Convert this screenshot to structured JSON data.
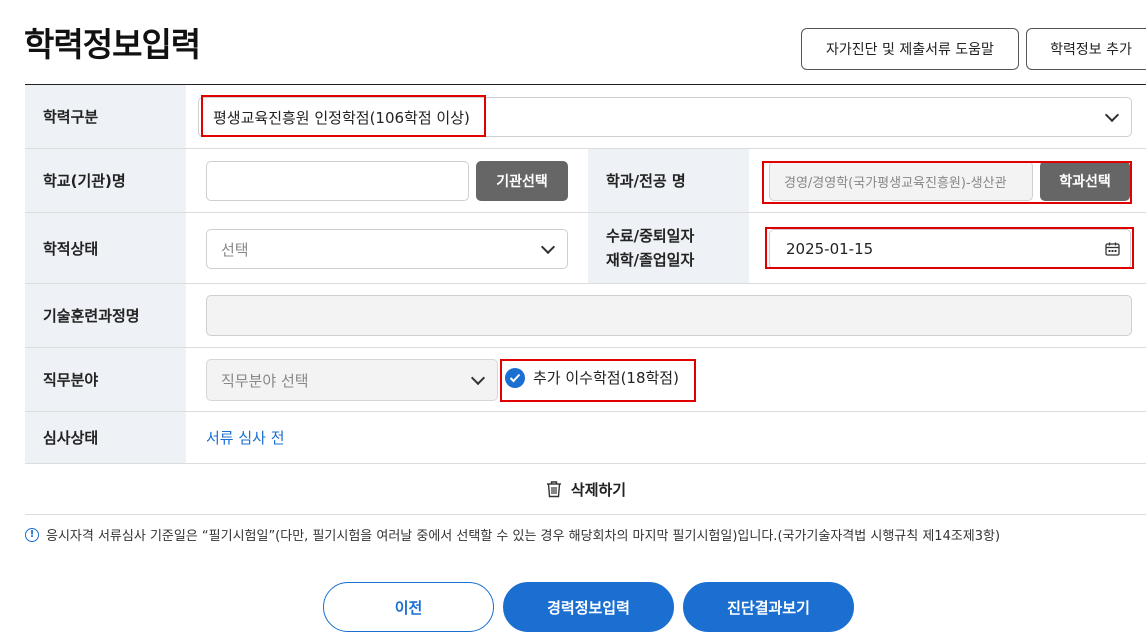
{
  "page": {
    "title": "학력정보입력"
  },
  "top_buttons": {
    "help": "자가진단 및 제출서류 도움말",
    "add": "학력정보 추가"
  },
  "form": {
    "education_type": {
      "label": "학력구분",
      "value": "평생교육진흥원 인정학점(106학점 이상)"
    },
    "school": {
      "label": "학교(기관)명",
      "value": "",
      "button": "기관선택"
    },
    "major": {
      "label": "학과/전공 명",
      "value": "경영/경영학(국가평생교육진흥원)-생산관",
      "button": "학과선택"
    },
    "status": {
      "label": "학적상태",
      "value": "선택"
    },
    "date": {
      "label_line1": "수료/중퇴일자",
      "label_line2": "재학/졸업일자",
      "value": "2025-01-15"
    },
    "training": {
      "label": "기술훈련과정명",
      "value": ""
    },
    "job_field": {
      "label": "직무분야",
      "value": "직무분야 선택",
      "checkbox_label": "추가 이수학점(18학점)",
      "checked": true
    },
    "review": {
      "label": "심사상태",
      "value": "서류 심사 전"
    }
  },
  "delete_label": "삭제하기",
  "notice": "응시자격 서류심사 기준일은 “필기시험일”(다만, 필기시험을 여러날 중에서 선택할 수 있는 경우 해당회차의 마지막 필기시험일)입니다.(국가기술자격법 시행규칙 제14조제3항)",
  "bottom_buttons": {
    "prev": "이전",
    "career": "경력정보입력",
    "result": "진단결과보기"
  },
  "colors": {
    "accent": "#1a6fd1",
    "highlight": "#e00000",
    "label_bg": "#eef1f6",
    "dark_button": "#666666"
  }
}
